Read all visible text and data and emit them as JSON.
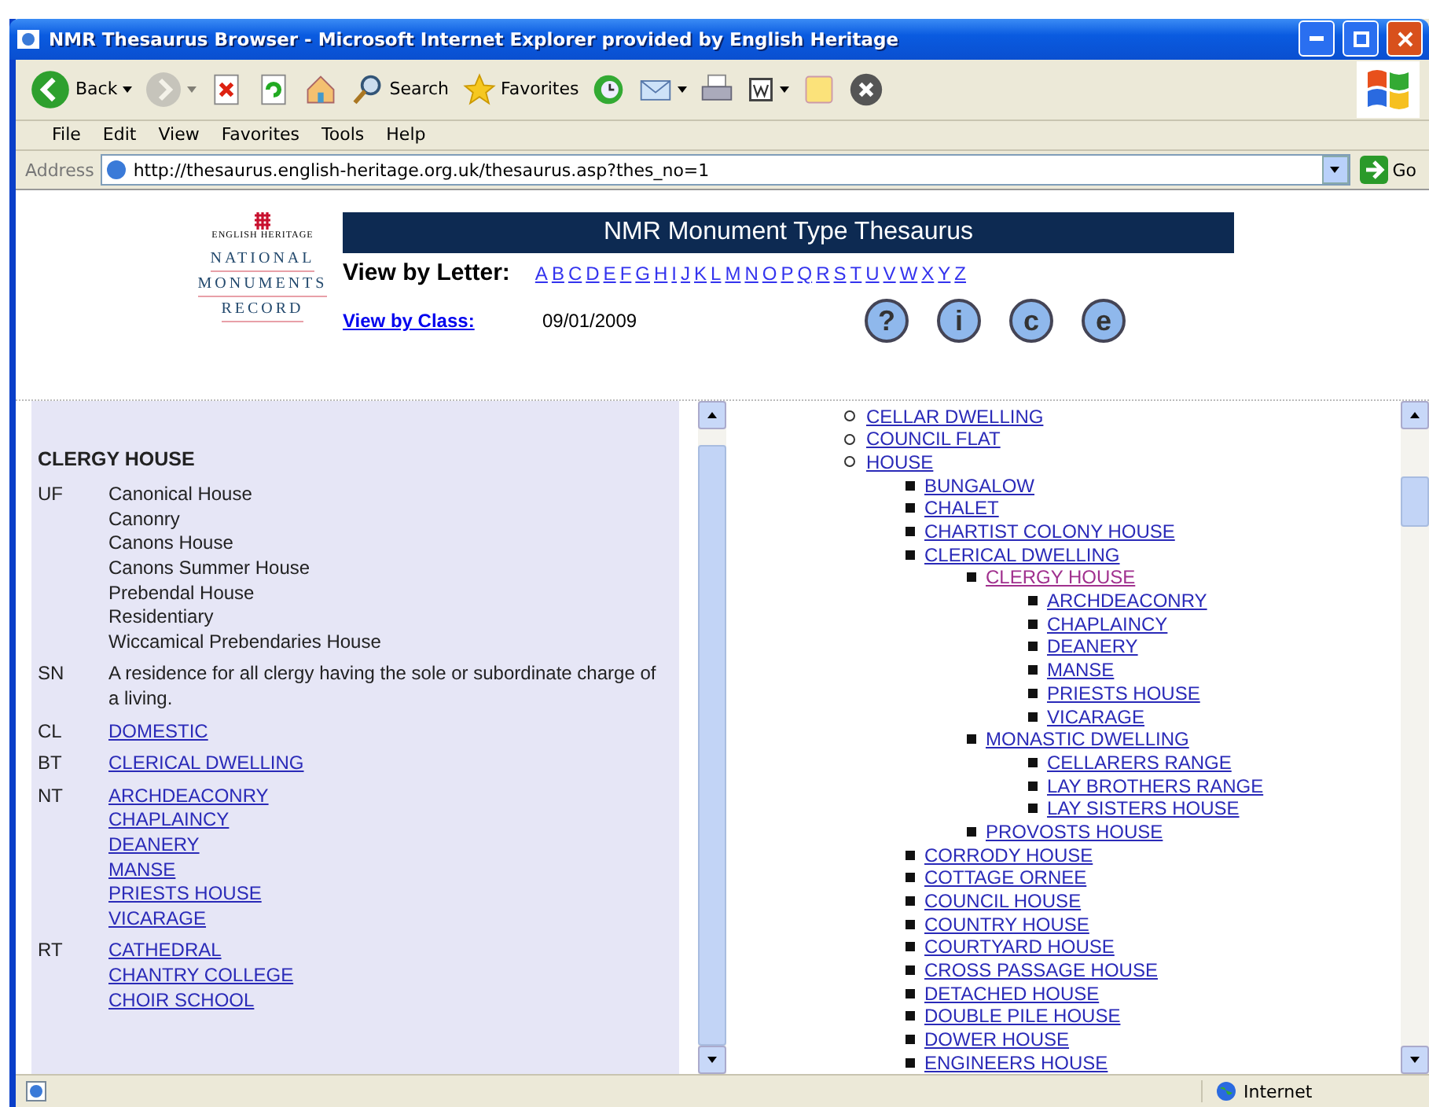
{
  "window": {
    "title": "NMR Thesaurus Browser - Microsoft Internet Explorer provided by English Heritage"
  },
  "toolbar": [
    {
      "kind": "back",
      "label": "Back",
      "dropdown": true,
      "disabled": false
    },
    {
      "kind": "forward",
      "dropdown": true,
      "disabled": true
    },
    {
      "kind": "stop",
      "dropdown": false,
      "disabled": false
    },
    {
      "kind": "refresh",
      "dropdown": false,
      "disabled": false
    },
    {
      "kind": "home",
      "dropdown": false,
      "disabled": false
    },
    {
      "kind": "search",
      "label": "Search",
      "dropdown": false,
      "disabled": false
    },
    {
      "kind": "favorites",
      "label": "Favorites",
      "dropdown": false,
      "disabled": false
    },
    {
      "kind": "history",
      "dropdown": false,
      "disabled": false
    },
    {
      "kind": "mail",
      "dropdown": true,
      "disabled": false
    },
    {
      "kind": "print",
      "dropdown": false,
      "disabled": false
    },
    {
      "kind": "edit",
      "dropdown": true,
      "disabled": false
    },
    {
      "kind": "note",
      "dropdown": false,
      "disabled": false
    },
    {
      "kind": "close",
      "dropdown": false,
      "disabled": false
    }
  ],
  "menu": [
    "File",
    "Edit",
    "View",
    "Favorites",
    "Tools",
    "Help"
  ],
  "address": {
    "label": "Address",
    "value": "http://thesaurus.english-heritage.org.uk/thesaurus.asp?thes_no=1",
    "go": "Go"
  },
  "header": {
    "logo_top": "ENGLISH HERITAGE",
    "logo_lines": [
      "NATIONAL",
      "MONUMENTS",
      "RECORD"
    ],
    "title": "NMR Monument Type Thesaurus",
    "letter_label": "View by Letter:",
    "letters": [
      "A",
      "B",
      "C",
      "D",
      "E",
      "F",
      "G",
      "H",
      "I",
      "J",
      "K",
      "L",
      "M",
      "N",
      "O",
      "P",
      "Q",
      "R",
      "S",
      "T",
      "U",
      "V",
      "W",
      "X",
      "Y",
      "Z"
    ],
    "class_link": "View by Class:",
    "date": "09/01/2009",
    "help_buttons": [
      "?",
      "i",
      "c",
      "e"
    ]
  },
  "term": {
    "heading": "CLERGY HOUSE",
    "sections": [
      {
        "code": "UF",
        "kind": "text",
        "values": [
          "Canonical House",
          "Canonry",
          "Canons House",
          "Canons Summer House",
          "Prebendal House",
          "Residentiary",
          "Wiccamical Prebendaries House"
        ]
      },
      {
        "code": "SN",
        "kind": "text",
        "values": [
          "A residence for all clergy having the sole or subordinate charge of a living."
        ]
      },
      {
        "code": "CL",
        "kind": "link",
        "values": [
          "DOMESTIC"
        ]
      },
      {
        "code": "BT",
        "kind": "link",
        "values": [
          "CLERICAL DWELLING"
        ]
      },
      {
        "code": "NT",
        "kind": "link",
        "values": [
          "ARCHDEACONRY",
          "CHAPLAINCY",
          "DEANERY",
          "MANSE",
          "PRIESTS HOUSE",
          "VICARAGE"
        ]
      },
      {
        "code": "RT",
        "kind": "link",
        "values": [
          "CATHEDRAL",
          "CHANTRY COLLEGE",
          "CHOIR SCHOOL"
        ]
      }
    ]
  },
  "tree": [
    {
      "text": "CELLAR DWELLING",
      "selected": false
    },
    {
      "text": "COUNCIL FLAT",
      "selected": false
    },
    {
      "text": "HOUSE",
      "selected": false,
      "children": [
        {
          "text": "BUNGALOW",
          "selected": false
        },
        {
          "text": "CHALET",
          "selected": false
        },
        {
          "text": "CHARTIST COLONY HOUSE",
          "selected": false
        },
        {
          "text": "CLERICAL DWELLING",
          "selected": false,
          "children": [
            {
              "text": "CLERGY HOUSE",
              "selected": true,
              "children": [
                {
                  "text": "ARCHDEACONRY",
                  "selected": false
                },
                {
                  "text": "CHAPLAINCY",
                  "selected": false
                },
                {
                  "text": "DEANERY",
                  "selected": false
                },
                {
                  "text": "MANSE",
                  "selected": false
                },
                {
                  "text": "PRIESTS HOUSE",
                  "selected": false
                },
                {
                  "text": "VICARAGE",
                  "selected": false
                }
              ]
            },
            {
              "text": "MONASTIC DWELLING",
              "selected": false,
              "children": [
                {
                  "text": "CELLARERS RANGE",
                  "selected": false
                },
                {
                  "text": "LAY BROTHERS RANGE",
                  "selected": false
                },
                {
                  "text": "LAY SISTERS HOUSE",
                  "selected": false
                }
              ]
            },
            {
              "text": "PROVOSTS HOUSE",
              "selected": false
            }
          ]
        },
        {
          "text": "CORRODY HOUSE",
          "selected": false
        },
        {
          "text": "COTTAGE ORNEE",
          "selected": false
        },
        {
          "text": "COUNCIL HOUSE",
          "selected": false
        },
        {
          "text": "COUNTRY HOUSE",
          "selected": false
        },
        {
          "text": "COURTYARD HOUSE",
          "selected": false
        },
        {
          "text": "CROSS PASSAGE HOUSE",
          "selected": false
        },
        {
          "text": "DETACHED HOUSE",
          "selected": false
        },
        {
          "text": "DOUBLE PILE HOUSE",
          "selected": false
        },
        {
          "text": "DOWER HOUSE",
          "selected": false
        },
        {
          "text": "ENGINEERS HOUSE",
          "selected": false
        }
      ]
    }
  ],
  "status": {
    "zone": "Internet"
  }
}
